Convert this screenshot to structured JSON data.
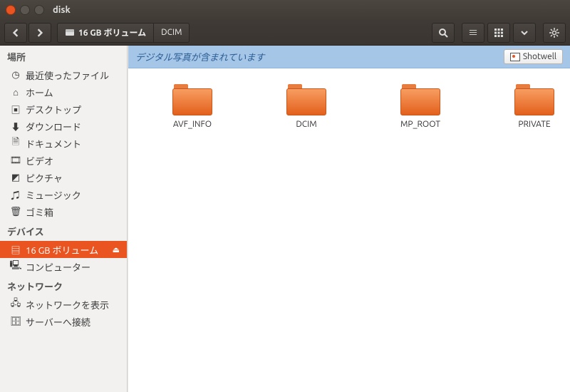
{
  "window": {
    "title": "disk"
  },
  "toolbar": {
    "path": [
      {
        "label": "16 GB ボリューム",
        "icon": "drive"
      },
      {
        "label": "DCIM"
      }
    ]
  },
  "sidebar": {
    "sections": [
      {
        "header": "場所",
        "items": [
          {
            "icon": "recent",
            "label": "最近使ったファイル"
          },
          {
            "icon": "home",
            "label": "ホーム"
          },
          {
            "icon": "desktop",
            "label": "デスクトップ"
          },
          {
            "icon": "download",
            "label": "ダウンロード"
          },
          {
            "icon": "documents",
            "label": "ドキュメント"
          },
          {
            "icon": "videos",
            "label": "ビデオ"
          },
          {
            "icon": "pictures",
            "label": "ピクチャ"
          },
          {
            "icon": "music",
            "label": "ミュージック"
          },
          {
            "icon": "trash",
            "label": "ゴミ箱"
          }
        ]
      },
      {
        "header": "デバイス",
        "items": [
          {
            "icon": "drive",
            "label": "16 GB ボリューム",
            "active": true,
            "ejectable": true
          },
          {
            "icon": "computer",
            "label": "コンピューター"
          }
        ]
      },
      {
        "header": "ネットワーク",
        "items": [
          {
            "icon": "network",
            "label": "ネットワークを表示"
          },
          {
            "icon": "connect",
            "label": "サーバーへ接続"
          }
        ]
      }
    ]
  },
  "infobar": {
    "message": "デジタル写真が含まれています",
    "app_button": "Shotwell"
  },
  "folders": [
    {
      "name": "AVF_INFO"
    },
    {
      "name": "DCIM"
    },
    {
      "name": "MP_ROOT"
    },
    {
      "name": "PRIVATE"
    }
  ]
}
